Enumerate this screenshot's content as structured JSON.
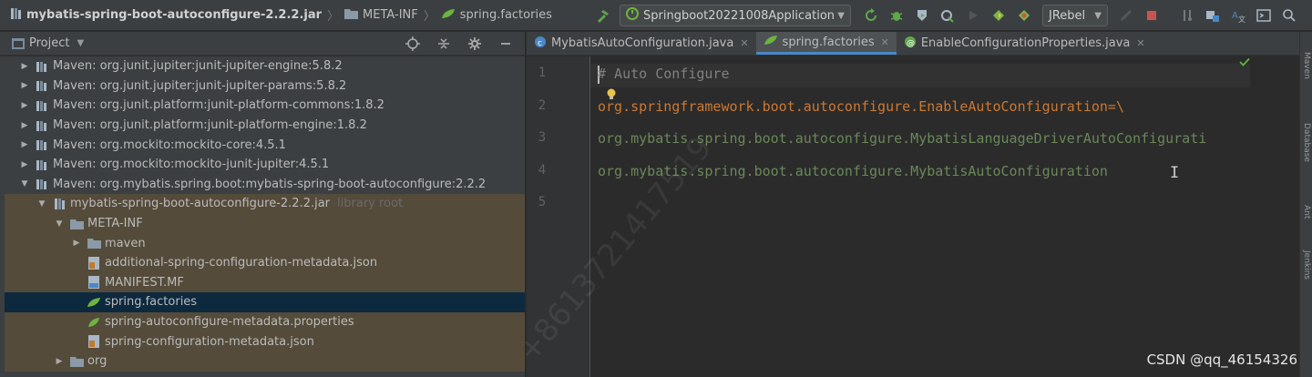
{
  "navbar": {
    "crumbs": [
      {
        "label": "mybatis-spring-boot-autoconfigure-2.2.2.jar",
        "icon": "jar-icon"
      },
      {
        "label": "META-INF",
        "icon": "folder-icon"
      },
      {
        "label": "spring.factories",
        "icon": "spring-factories-icon"
      }
    ],
    "run_configuration": "Springboot20221008Application",
    "jrebel": "JRebel"
  },
  "project": {
    "title": "Project",
    "tree": [
      {
        "label": "Maven: org.junit.jupiter:junit-jupiter-engine:5.8.2",
        "level": 1,
        "arrow": "▶",
        "icon": "library-icon"
      },
      {
        "label": "Maven: org.junit.jupiter:junit-jupiter-params:5.8.2",
        "level": 1,
        "arrow": "▶",
        "icon": "library-icon"
      },
      {
        "label": "Maven: org.junit.platform:junit-platform-commons:1.8.2",
        "level": 1,
        "arrow": "▶",
        "icon": "library-icon"
      },
      {
        "label": "Maven: org.junit.platform:junit-platform-engine:1.8.2",
        "level": 1,
        "arrow": "▶",
        "icon": "library-icon"
      },
      {
        "label": "Maven: org.mockito:mockito-core:4.5.1",
        "level": 1,
        "arrow": "▶",
        "icon": "library-icon"
      },
      {
        "label": "Maven: org.mockito:mockito-junit-jupiter:4.5.1",
        "level": 1,
        "arrow": "▶",
        "icon": "library-icon"
      },
      {
        "label": "Maven: org.mybatis.spring.boot:mybatis-spring-boot-autoconfigure:2.2.2",
        "level": 1,
        "arrow": "▼",
        "icon": "library-icon"
      },
      {
        "label": "mybatis-spring-boot-autoconfigure-2.2.2.jar",
        "secondary": "library root",
        "level": 2,
        "arrow": "▼",
        "icon": "jar-icon",
        "tan": true
      },
      {
        "label": "META-INF",
        "level": 3,
        "arrow": "▼",
        "icon": "folder-icon",
        "tan": true
      },
      {
        "label": "maven",
        "level": 4,
        "arrow": "▶",
        "icon": "folder-icon",
        "tan": true
      },
      {
        "label": "additional-spring-configuration-metadata.json",
        "level": 4,
        "arrow": "",
        "icon": "json-file-icon",
        "tan": true
      },
      {
        "label": "MANIFEST.MF",
        "level": 4,
        "arrow": "",
        "icon": "manifest-file-icon",
        "tan": true
      },
      {
        "label": "spring.factories",
        "level": 4,
        "arrow": "",
        "icon": "spring-factories-icon",
        "selected": true
      },
      {
        "label": "spring-autoconfigure-metadata.properties",
        "level": 4,
        "arrow": "",
        "icon": "properties-file-icon",
        "tan": true
      },
      {
        "label": "spring-configuration-metadata.json",
        "level": 4,
        "arrow": "",
        "icon": "json-file-icon",
        "tan": true
      },
      {
        "label": "org",
        "level": 3,
        "arrow": "▶",
        "icon": "folder-icon",
        "tan": true
      }
    ]
  },
  "editor": {
    "tabs": [
      {
        "label": "MybatisAutoConfiguration.java",
        "icon": "java-class-icon"
      },
      {
        "label": "spring.factories",
        "icon": "spring-factories-icon",
        "active": true
      },
      {
        "label": "EnableConfigurationProperties.java",
        "icon": "java-annotation-icon"
      }
    ],
    "lines": [
      {
        "number": "1",
        "parts": [
          {
            "text": "# Auto Configure",
            "cls": "c-comment"
          }
        ]
      },
      {
        "number": "2",
        "parts": [
          {
            "text": "org.springframework.boot.autoconfigure.EnableAutoConfiguration",
            "cls": "c-key"
          },
          {
            "text": "=\\",
            "cls": "c-key"
          }
        ]
      },
      {
        "number": "3",
        "parts": [
          {
            "text": "org.mybatis.spring.boot.autoconfigure.MybatisLanguageDriverAutoConfigurati",
            "cls": "c-val"
          }
        ]
      },
      {
        "number": "4",
        "parts": [
          {
            "text": "org.mybatis.spring.boot.autoconfigure.MybatisAutoConfiguration",
            "cls": "c-val"
          }
        ]
      },
      {
        "number": "5",
        "parts": []
      }
    ]
  },
  "right_panel": {
    "labels": [
      "Maven",
      "Database",
      "Ant",
      "Jenkins"
    ]
  },
  "watermarks": {
    "code_watermark": "+8613721417519",
    "csdn": "CSDN @qq_46154326"
  },
  "colors": {
    "accent": "#4a88c7",
    "selection": "#0d293e",
    "library_highlight": "#544b3a",
    "keyword_orange": "#cc7832",
    "string_green": "#6a8759"
  }
}
